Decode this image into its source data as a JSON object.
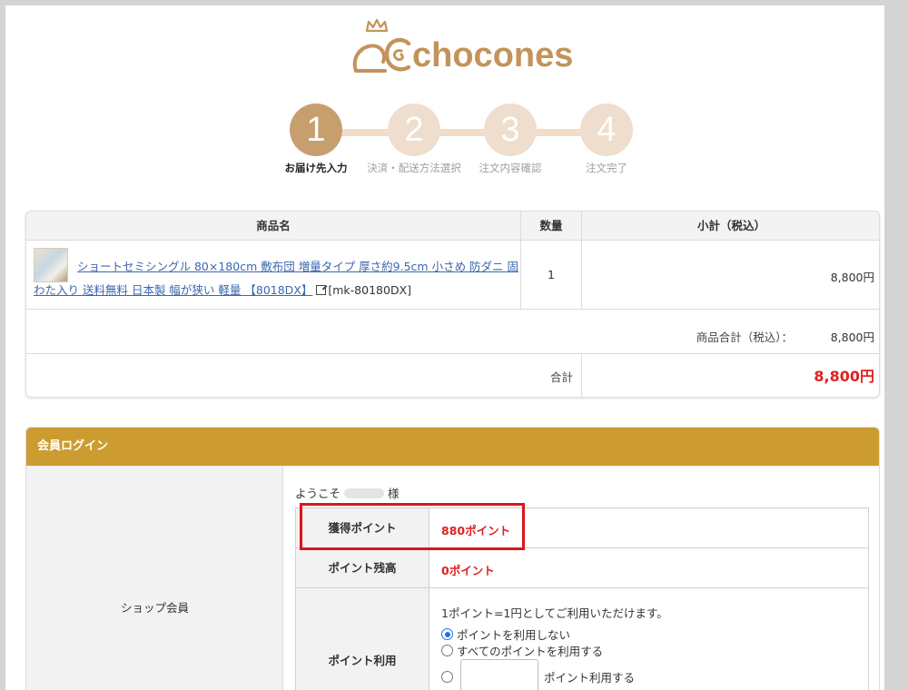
{
  "header": {
    "logo_text": "chocones",
    "brand_color": "#c3935a"
  },
  "steps": [
    {
      "number": "1",
      "label": "お届け先入力",
      "active": true
    },
    {
      "number": "2",
      "label": "決済・配送方法選択",
      "active": false
    },
    {
      "number": "3",
      "label": "注文内容確認",
      "active": false
    },
    {
      "number": "4",
      "label": "注文完了",
      "active": false
    }
  ],
  "cart": {
    "headers": {
      "product": "商品名",
      "quantity": "数量",
      "subtotal": "小計（税込）"
    },
    "items": [
      {
        "name": "ショートセミシングル 80×180cm 敷布団 増量タイプ 厚さ約9.5cm 小さめ 防ダニ 固わた入り 送料無料 日本製 幅が狭い 軽量 【8018DX】",
        "sku": "[mk-80180DX]",
        "quantity": "1",
        "subtotal": "8,800円"
      }
    ],
    "goods_total_label": "商品合計（税込）：",
    "goods_total_value": "8,800円",
    "total_label": "合計",
    "total_value": "8,800円",
    "total_color": "#e02020"
  },
  "login": {
    "title": "会員ログイン",
    "header_color": "#cc9c31",
    "side_label": "ショップ会員",
    "welcome_prefix": "ようこそ",
    "welcome_suffix": "様",
    "earned_label": "獲得ポイント",
    "earned_value": "880ポイント",
    "balance_label": "ポイント残高",
    "balance_value": "0ポイント",
    "use_label": "ポイント利用",
    "use_note": "1ポイント=1円としてご利用いただけます。",
    "options": {
      "no_use": "ポイントを利用しない",
      "use_all": "すべてのポイントを利用する",
      "use_custom_suffix": "ポイント利用する"
    },
    "custom_points_value": "",
    "selected_option": "no_use"
  }
}
